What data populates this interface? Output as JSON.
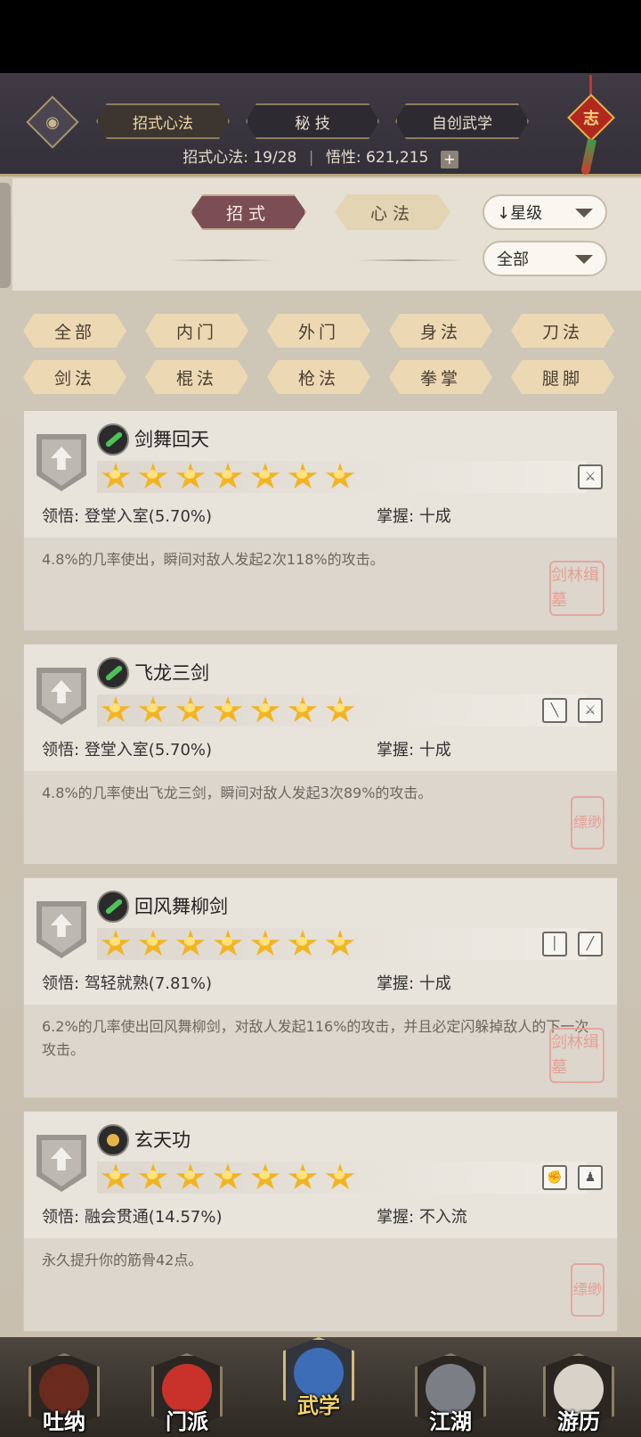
{
  "header": {
    "tabs": [
      {
        "label": "招式心法",
        "active": true
      },
      {
        "label": "秘 技",
        "active": false
      },
      {
        "label": "自创武学",
        "active": false
      }
    ],
    "stats_label": "招式心法:",
    "stats_value": "19/28",
    "wuxing_label": "悟性:",
    "wuxing_value": "621,215",
    "plus": "+",
    "charm_char": "志"
  },
  "sub_tabs": [
    {
      "label": "招式",
      "active": true
    },
    {
      "label": "心法",
      "active": false
    }
  ],
  "sort_dropdown": "↓星级",
  "filter_dropdown": "全部",
  "filters": [
    {
      "label": "全部",
      "active": true
    },
    {
      "label": "内门",
      "active": false
    },
    {
      "label": "外门",
      "active": false
    },
    {
      "label": "身法",
      "active": false
    },
    {
      "label": "刀法",
      "active": false
    },
    {
      "label": "剑法",
      "active": false
    },
    {
      "label": "棍法",
      "active": false
    },
    {
      "label": "枪法",
      "active": false
    },
    {
      "label": "拳掌",
      "active": false
    },
    {
      "label": "腿脚",
      "active": false
    }
  ],
  "skills": [
    {
      "name": "剑舞回天",
      "stars": 7,
      "lingwu_label": "领悟:",
      "lingwu": "登堂入室(5.70%)",
      "zhangwo_label": "掌握:",
      "zhangwo": "十成",
      "desc": "4.8%的几率使出，瞬间对敌人发起2次118%的攻击。",
      "seal": "剑林缉墓",
      "seal_size": "big",
      "weapon_icons": [
        "sword-whip-icon"
      ]
    },
    {
      "name": "飞龙三剑",
      "stars": 7,
      "lingwu_label": "领悟:",
      "lingwu": "登堂入室(5.70%)",
      "zhangwo_label": "掌握:",
      "zhangwo": "十成",
      "desc": "4.8%的几率使出飞龙三剑，瞬间对敌人发起3次89%的攻击。",
      "seal": "缥缈",
      "seal_size": "small",
      "weapon_icons": [
        "sword-icon",
        "sword-whip-icon"
      ]
    },
    {
      "name": "回风舞柳剑",
      "stars": 7,
      "lingwu_label": "领悟:",
      "lingwu": "驾轻就熟(7.81%)",
      "zhangwo_label": "掌握:",
      "zhangwo": "十成",
      "desc": "6.2%的几率使出回风舞柳剑，对敌人发起116%的攻击，并且必定闪躲掉敌人的下一次攻击。",
      "seal": "剑林缉墓",
      "seal_size": "big",
      "weapon_icons": [
        "staff-icon",
        "blade-icon"
      ]
    },
    {
      "name": "玄天功",
      "stars": 7,
      "lingwu_label": "领悟:",
      "lingwu": "融会贯通(14.57%)",
      "zhangwo_label": "掌握:",
      "zhangwo": "不入流",
      "desc": "永久提升你的筋骨42点。",
      "seal": "缥缈",
      "seal_size": "small",
      "weapon_icons": [
        "fist-icon",
        "figure-icon"
      ]
    }
  ],
  "nav": [
    {
      "label": "吐纳",
      "active": false,
      "art": "#6a2a1e"
    },
    {
      "label": "门派",
      "active": false,
      "art": "#c9322a"
    },
    {
      "label": "武学",
      "active": true,
      "art": "#3d6db7"
    },
    {
      "label": "江湖",
      "active": false,
      "art": "#7a7f86"
    },
    {
      "label": "游历",
      "active": false,
      "art": "#d8d2c8"
    }
  ]
}
